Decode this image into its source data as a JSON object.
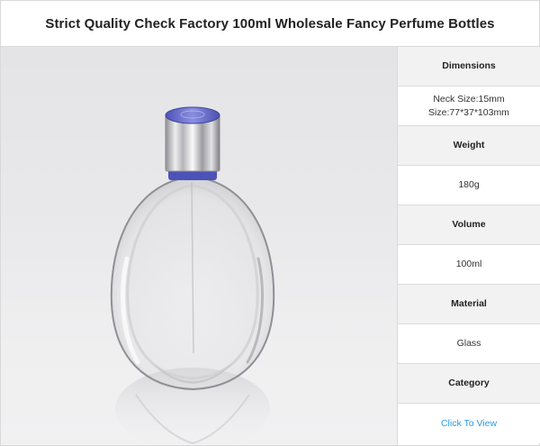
{
  "page": {
    "title": "Strict Quality Check Factory 100ml Wholesale Fancy Perfume Bottles"
  },
  "product_image": {
    "subject": "perfume-bottle"
  },
  "specs": [
    {
      "label": "Dimensions",
      "values": [
        "Neck Size:15mm",
        "Size:77*37*103mm"
      ]
    },
    {
      "label": "Weight",
      "values": [
        "180g"
      ]
    },
    {
      "label": "Volume",
      "values": [
        "100ml"
      ]
    },
    {
      "label": "Material",
      "values": [
        "Glass"
      ]
    },
    {
      "label": "Category",
      "values": [],
      "link_text": "Click To View",
      "link_color": "#2b9be6"
    }
  ],
  "colors": {
    "header_background": "#f2f2f2",
    "border": "#d9d9d9",
    "link": "#2b9be6",
    "cap_top": "#6a6fd0"
  }
}
